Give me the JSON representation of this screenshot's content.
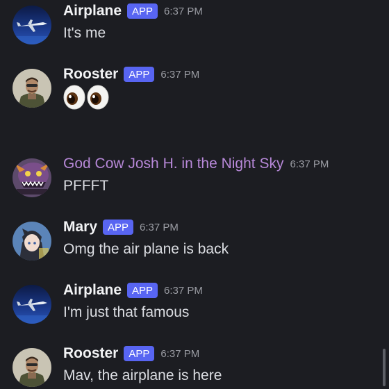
{
  "messages": [
    {
      "author": "Airplane",
      "badge": "APP",
      "time": "6:37 PM",
      "text": "It's me",
      "avatar_icon": "airplane-avatar"
    },
    {
      "author": "Rooster",
      "badge": "APP",
      "time": "6:37 PM",
      "emoji": "eyes",
      "avatar_icon": "pilot-avatar"
    },
    {
      "author": "God Cow Josh H. in the Night Sky",
      "time": "6:37 PM",
      "text": "PFFFT",
      "author_color": "#b788d8",
      "avatar_icon": "creature-avatar"
    },
    {
      "author": "Mary",
      "badge": "APP",
      "time": "6:37 PM",
      "text": "Omg the air plane is back",
      "avatar_icon": "anime-avatar"
    },
    {
      "author": "Airplane",
      "badge": "APP",
      "time": "6:37 PM",
      "text": "I'm just that famous",
      "avatar_icon": "airplane-avatar"
    },
    {
      "author": "Rooster",
      "badge": "APP",
      "time": "6:37 PM",
      "text": "Mav, the airplane is here",
      "avatar_icon": "pilot-avatar"
    }
  ],
  "colors": {
    "background": "#1c1d22",
    "badge": "#5865f2",
    "timestamp": "#9a9ca3",
    "purple_name": "#b788d8"
  }
}
